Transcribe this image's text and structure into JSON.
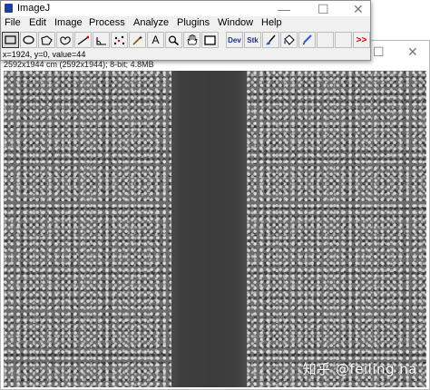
{
  "app": {
    "title": "ImageJ",
    "menu": [
      "File",
      "Edit",
      "Image",
      "Process",
      "Analyze",
      "Plugins",
      "Window",
      "Help"
    ],
    "status_text": "x=1924, y=0, value=44",
    "toolbar": {
      "tools": [
        {
          "icon": "rectangle-select-icon"
        },
        {
          "icon": "oval-select-icon"
        },
        {
          "icon": "polygon-select-icon"
        },
        {
          "icon": "freehand-select-icon"
        },
        {
          "icon": "line-tool-icon"
        },
        {
          "icon": "angle-tool-icon"
        },
        {
          "icon": "multipoint-tool-icon"
        },
        {
          "icon": "wand-tool-icon"
        },
        {
          "icon": "text-tool-icon",
          "label": "A"
        },
        {
          "icon": "magnifier-icon"
        },
        {
          "icon": "hand-scroll-icon"
        },
        {
          "icon": "color-picker-icon"
        },
        {
          "icon": "developer-menu-icon",
          "label": "Dev"
        },
        {
          "icon": "stack-tools-icon",
          "label": "Stk"
        },
        {
          "icon": "brush-tool-icon"
        },
        {
          "icon": "flood-fill-icon"
        },
        {
          "icon": "pencil-tool-icon"
        },
        {
          "icon": "more-tools-icon",
          "label": ">>"
        }
      ],
      "accent_color": "#cc0000"
    }
  },
  "image_window": {
    "info_text": "2592x1944 cm (2592x1944); 8-bit; 4.8MB",
    "watermark": "知乎 @feiling na"
  },
  "window_controls": {
    "minimize": "—",
    "maximize": "☐",
    "close": "✕"
  }
}
